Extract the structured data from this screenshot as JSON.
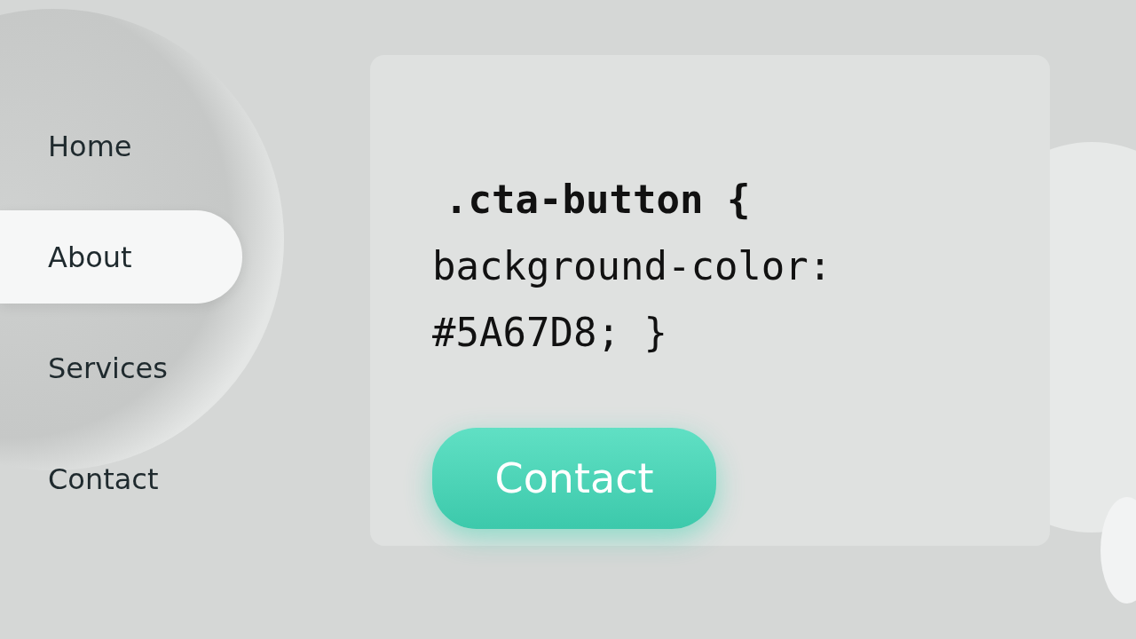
{
  "nav": {
    "items": [
      {
        "label": "Home",
        "selected": false
      },
      {
        "label": "About",
        "selected": true
      },
      {
        "label": "Services",
        "selected": false
      },
      {
        "label": "Contact",
        "selected": false
      }
    ]
  },
  "card": {
    "code_lines": [
      ".cta-button {",
      "background-color:",
      "#5A67D8; }"
    ],
    "button": {
      "label": "Contact"
    }
  }
}
